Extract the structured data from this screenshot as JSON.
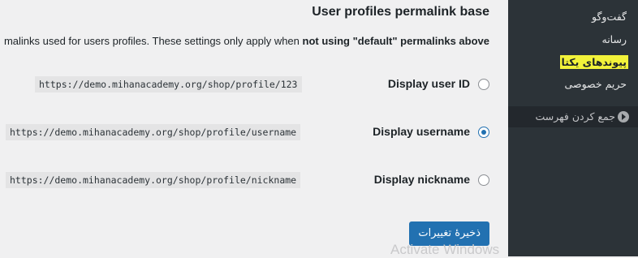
{
  "section": {
    "title": "User profiles permalink base",
    "description_prefix": "malinks used for users profiles. These settings only apply when ",
    "description_bold": "not using \"default\" permalinks above"
  },
  "options": [
    {
      "label": "Display user ID",
      "url": "https://demo.mihanacademy.org/shop/profile/123",
      "checked": false
    },
    {
      "label": "Display username",
      "url": "https://demo.mihanacademy.org/shop/profile/username",
      "checked": true
    },
    {
      "label": "Display nickname",
      "url": "https://demo.mihanacademy.org/shop/profile/nickname",
      "checked": false
    }
  ],
  "save_button": "ذخیرهٔ تغییرات",
  "watermark": "Activate Windows",
  "sidebar": {
    "items": [
      {
        "label": "گفت‌وگو",
        "active": false
      },
      {
        "label": "رسانه",
        "active": false
      },
      {
        "label": "پیوندهای یکتا",
        "active": true
      },
      {
        "label": "حریم خصوصی",
        "active": false
      }
    ],
    "collapse_label": "جمع کردن فهرست"
  },
  "colors": {
    "accent": "#2271b1",
    "sidebar_bg": "#2c3338",
    "highlight": "#f2f23a"
  }
}
